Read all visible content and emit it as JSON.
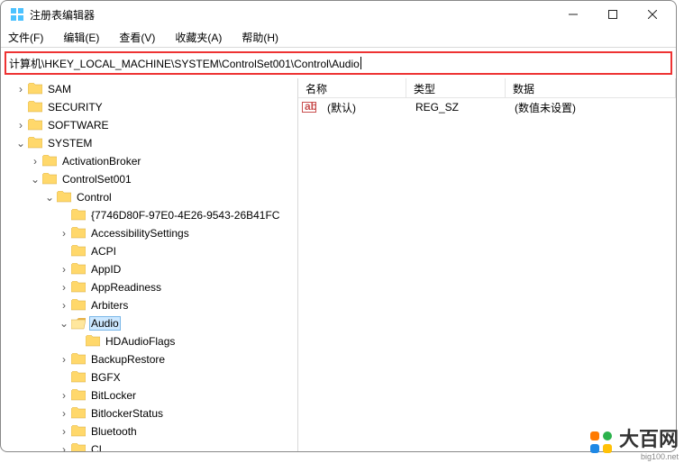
{
  "window": {
    "title": "注册表编辑器"
  },
  "menu": {
    "file": "文件(F)",
    "edit": "编辑(E)",
    "view": "查看(V)",
    "favorites": "收藏夹(A)",
    "help": "帮助(H)"
  },
  "address": {
    "path": "计算机\\HKEY_LOCAL_MACHINE\\SYSTEM\\ControlSet001\\Control\\Audio"
  },
  "tree": {
    "sam": "SAM",
    "security": "SECURITY",
    "software": "SOFTWARE",
    "system": "SYSTEM",
    "activationbroker": "ActivationBroker",
    "controlset001": "ControlSet001",
    "control": "Control",
    "guid": "{7746D80F-97E0-4E26-9543-26B41FC",
    "accessibility": "AccessibilitySettings",
    "acpi": "ACPI",
    "appid": "AppID",
    "appreadiness": "AppReadiness",
    "arbiters": "Arbiters",
    "audio": "Audio",
    "hdaudioflags": "HDAudioFlags",
    "backuprestore": "BackupRestore",
    "bgfx": "BGFX",
    "bitlocker": "BitLocker",
    "bitlockerstatus": "BitlockerStatus",
    "bluetooth": "Bluetooth",
    "ci": "CI"
  },
  "columns": {
    "name": "名称",
    "type": "类型",
    "data": "数据"
  },
  "value": {
    "name": "(默认)",
    "type": "REG_SZ",
    "data": "(数值未设置)"
  },
  "watermark": {
    "text": "大百网",
    "url": "big100.net"
  }
}
